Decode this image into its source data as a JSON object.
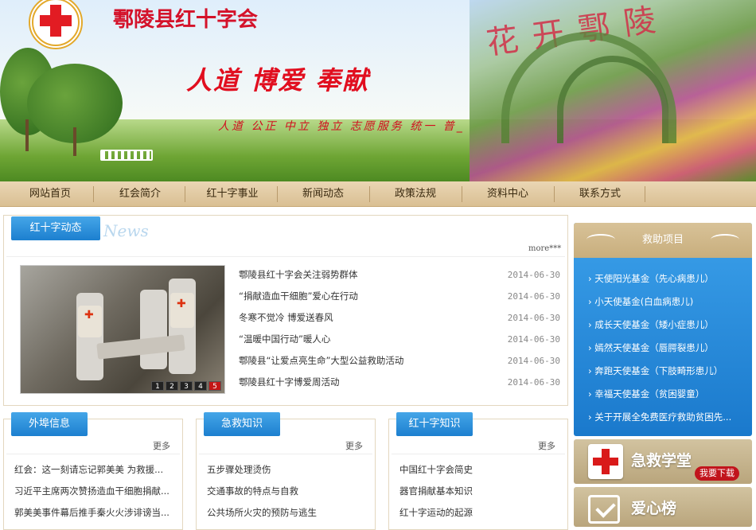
{
  "header": {
    "site_title": "鄠陵县红十字会",
    "motto": "人道 博爱 奉献",
    "slogan": "人道 公正 中立 独立 志愿服务 统一 普_",
    "garden_sign": "花开鄠陵"
  },
  "nav": {
    "items": [
      "网站首页",
      "红会简介",
      "红十字事业",
      "新闻动态",
      "政策法规",
      "资料中心",
      "联系方式"
    ]
  },
  "news": {
    "tab": "红十字动态",
    "tab_en": "News",
    "more": "more***",
    "items": [
      {
        "title": "鄠陵县红十字会关注弱势群体",
        "date": "2014-06-30"
      },
      {
        "title": "“捐献造血干细胞”爱心在行动",
        "date": "2014-06-30"
      },
      {
        "title": "冬寒不觉冷 博爱送春风",
        "date": "2014-06-30"
      },
      {
        "title": "“温暖中国行动”暖人心",
        "date": "2014-06-30"
      },
      {
        "title": "鄠陵县“让爱点亮生命”大型公益救助活动",
        "date": "2014-06-30"
      },
      {
        "title": "鄠陵县红十字博爱周活动",
        "date": "2014-06-30"
      }
    ],
    "pager": [
      "1",
      "2",
      "3",
      "4",
      "5"
    ]
  },
  "columns": [
    {
      "tab": "外埠信息",
      "more": "更多",
      "items": [
        "红会：这一刻请忘记郭美美 为救援...",
        "习近平主席两次赞扬造血干细胞捐献...",
        "郭美美事件幕后推手秦火火涉诽谤当..."
      ]
    },
    {
      "tab": "急救知识",
      "more": "更多",
      "items": [
        "五步骤处理烫伤",
        "交通事故的特点与自救",
        "公共场所火灾的预防与逃生"
      ]
    },
    {
      "tab": "红十字知识",
      "more": "更多",
      "items": [
        "中国红十字会简史",
        "器官捐献基本知识",
        "红十字运动的起源"
      ]
    }
  ],
  "aid": {
    "title": "救助项目",
    "items": [
      "天使阳光基金（先心病患儿）",
      "小天使基金(白血病患儿)",
      "成长天使基金（矮小症患儿）",
      "嫣然天使基金（唇腭裂患儿）",
      "奔跑天使基金（下肢畸形患儿）",
      "幸福天使基金（贫困婴童）",
      "关于开展全免费医疗救助贫困先..."
    ]
  },
  "boxes": {
    "first_aid": "急救学堂",
    "download": "我要下载",
    "love": "爱心榜"
  }
}
